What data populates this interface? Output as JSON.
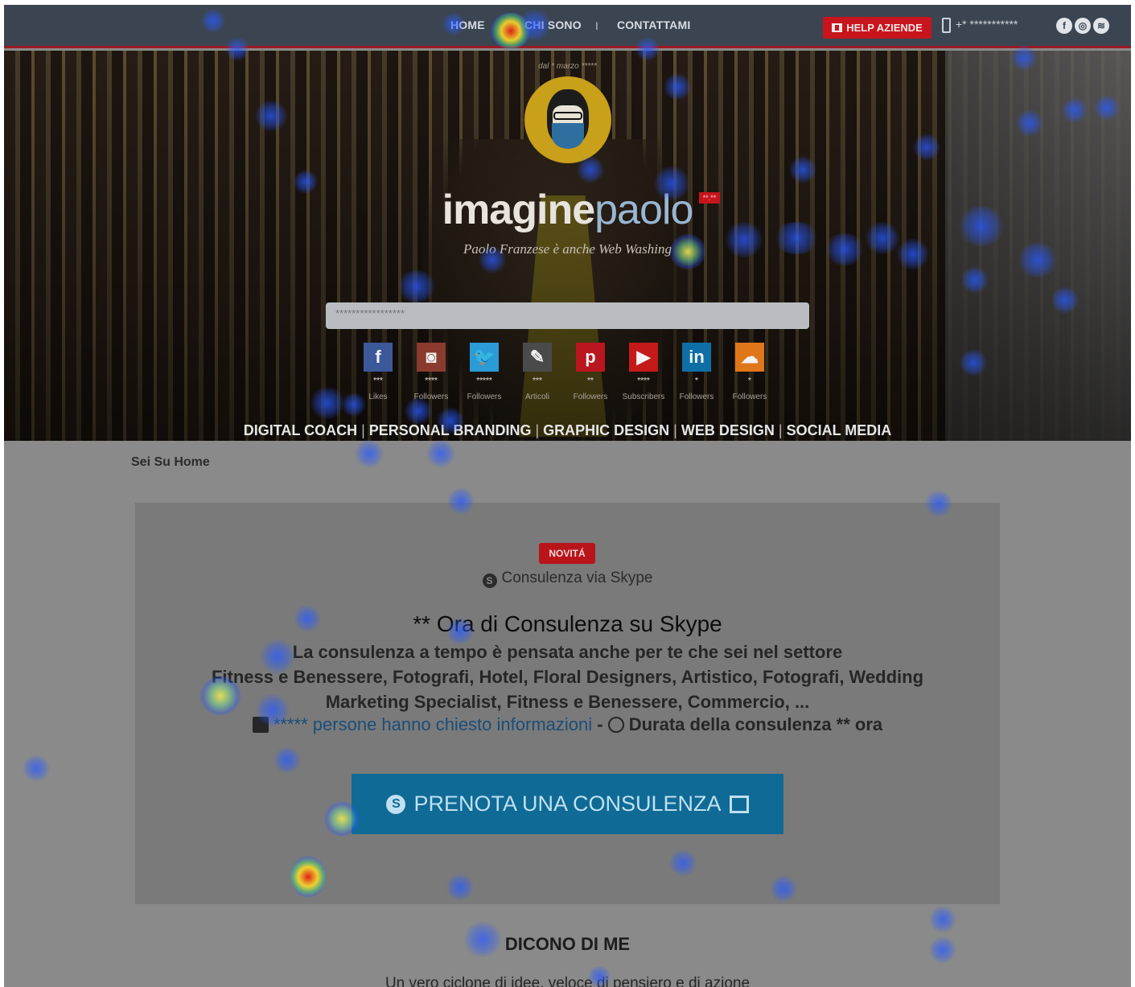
{
  "topbar": {
    "nav": [
      "HOME",
      "CHI SONO",
      "CONTATTAMI"
    ],
    "separator": "I",
    "help_button": "HELP AZIENDE",
    "phone": "+* ***********",
    "social_icons": [
      "facebook-icon",
      "instagram-icon",
      "spotify-icon"
    ]
  },
  "hero": {
    "date": "dal * marzo *****",
    "brand_part1": "imagine",
    "brand_part2": "paolo",
    "brand_badge": "**.**",
    "tagline": "Paolo Franzese è anche Web Washing",
    "search_placeholder": "*****************",
    "socials": [
      {
        "icon": "facebook-icon",
        "glyph": "f",
        "color": "#3b5998",
        "count": "***",
        "label": "Likes"
      },
      {
        "icon": "instagram-icon",
        "glyph": "◙",
        "color": "#8a3b2e",
        "count": "****",
        "label": "Followers"
      },
      {
        "icon": "twitter-icon",
        "glyph": "🐦",
        "color": "#2a9bd6",
        "count": "*****",
        "label": "Followers"
      },
      {
        "icon": "pencil-icon",
        "glyph": "✎",
        "color": "#4a4a4a",
        "count": "***",
        "label": "Articoli"
      },
      {
        "icon": "pinterest-icon",
        "glyph": "p",
        "color": "#b9161f",
        "count": "**",
        "label": "Followers"
      },
      {
        "icon": "youtube-icon",
        "glyph": "▶",
        "color": "#c41a1a",
        "count": "****",
        "label": "Subscribers"
      },
      {
        "icon": "linkedin-icon",
        "glyph": "in",
        "color": "#0d6fa5",
        "count": "*",
        "label": "Followers"
      },
      {
        "icon": "soundcloud-icon",
        "glyph": "☁",
        "color": "#e0761a",
        "count": "*",
        "label": "Followers"
      }
    ],
    "services": [
      "DIGITAL COACH",
      "PERSONAL BRANDING",
      "GRAPHIC DESIGN",
      "WEB DESIGN",
      "SOCIAL MEDIA"
    ]
  },
  "main": {
    "breadcrumb": "Sei Su Home",
    "badge": "NOVITÁ",
    "skype_line": "Consulenza via Skype",
    "heading": "** Ora di Consulenza su Skype",
    "para_lines": [
      "La consulenza a tempo è pensata anche per te che sei nel settore",
      "Fitness e Benessere, Fotografi, Hotel, Floral Designers, Artistico, Fotografi, Wedding",
      "Marketing Specialist, Fitness e Benessere, Commercio, ..."
    ],
    "info_count": "*****",
    "info_link": "persone hanno chiesto informazioni",
    "info_dash": "-",
    "info_duration": "Durata della consulenza ** ora",
    "cta": "PRENOTA UNA CONSULENZA",
    "section_title": "DICONO DI ME",
    "quote": "Un vero ciclone di idee, veloce di pensiero e di azione"
  }
}
